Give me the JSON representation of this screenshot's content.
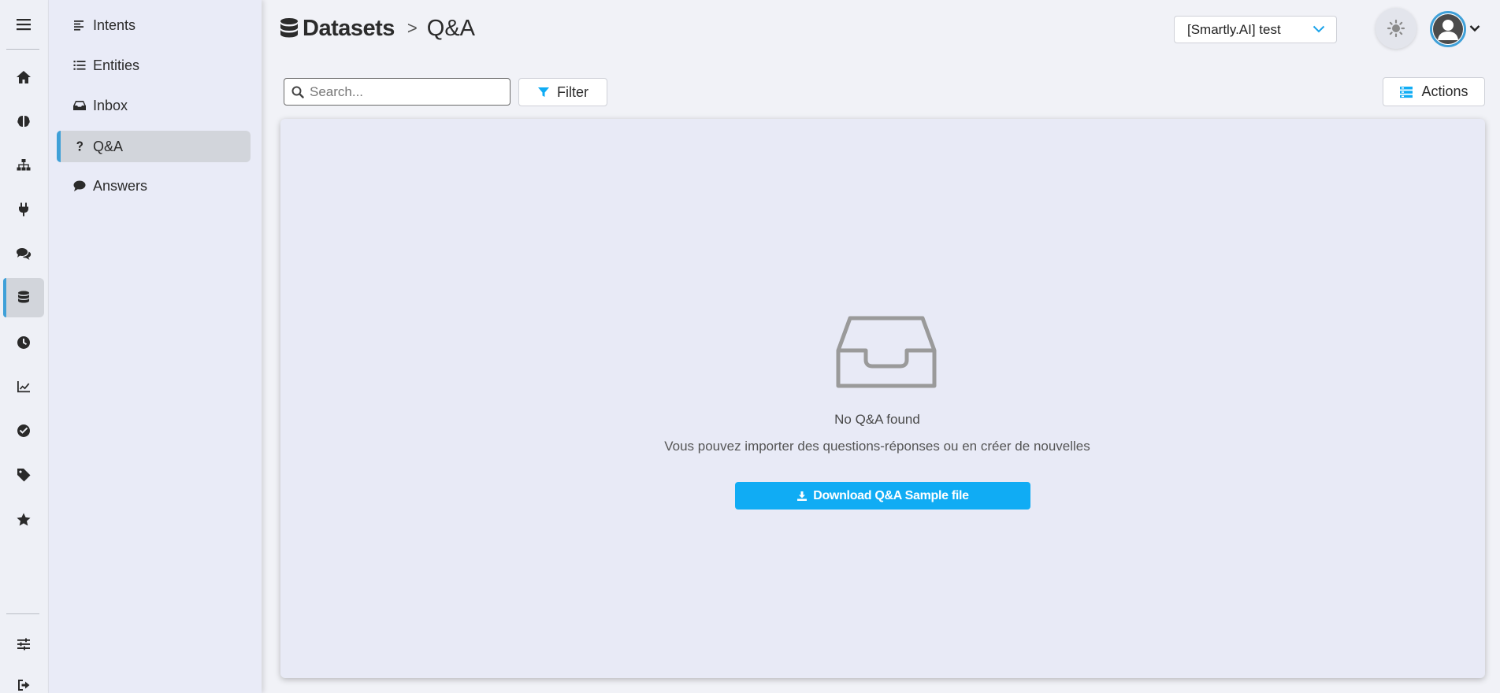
{
  "breadcrumb": {
    "section": "Datasets",
    "separator": ">",
    "page": "Q&A"
  },
  "project_select": {
    "value": "[Smartly.AI] test"
  },
  "rail": {
    "items": [
      {
        "icon": "menu-icon"
      },
      {
        "icon": "home-icon"
      },
      {
        "icon": "brain-icon"
      },
      {
        "icon": "sitemap-icon"
      },
      {
        "icon": "plug-icon"
      },
      {
        "icon": "comments-icon"
      },
      {
        "icon": "database-icon",
        "active": true
      },
      {
        "icon": "clock-icon"
      },
      {
        "icon": "chart-line-icon"
      },
      {
        "icon": "check-circle-icon"
      },
      {
        "icon": "tag-icon"
      },
      {
        "icon": "star-icon"
      },
      {
        "icon": "sliders-icon"
      },
      {
        "icon": "sign-out-icon"
      }
    ]
  },
  "subnav": {
    "items": [
      {
        "label": "Intents",
        "icon": "align-left-icon"
      },
      {
        "label": "Entities",
        "icon": "list-icon"
      },
      {
        "label": "Inbox",
        "icon": "inbox-icon"
      },
      {
        "label": "Q&A",
        "icon": "question-icon",
        "active": true
      },
      {
        "label": "Answers",
        "icon": "comment-icon"
      }
    ]
  },
  "toolbar": {
    "search_placeholder": "Search...",
    "filter_label": "Filter",
    "actions_label": "Actions"
  },
  "empty_state": {
    "icon": "inbox-tray-icon",
    "title": "No Q&A found",
    "subtitle": "Vous pouvez importer des questions-réponses ou en créer de nouvelles",
    "download_label": "Download Q&A Sample file"
  },
  "colors": {
    "accent": "#10acf4",
    "active_marker": "#3fa0d8",
    "background": "#f1f2f7",
    "panel": "#e8eaf6"
  }
}
